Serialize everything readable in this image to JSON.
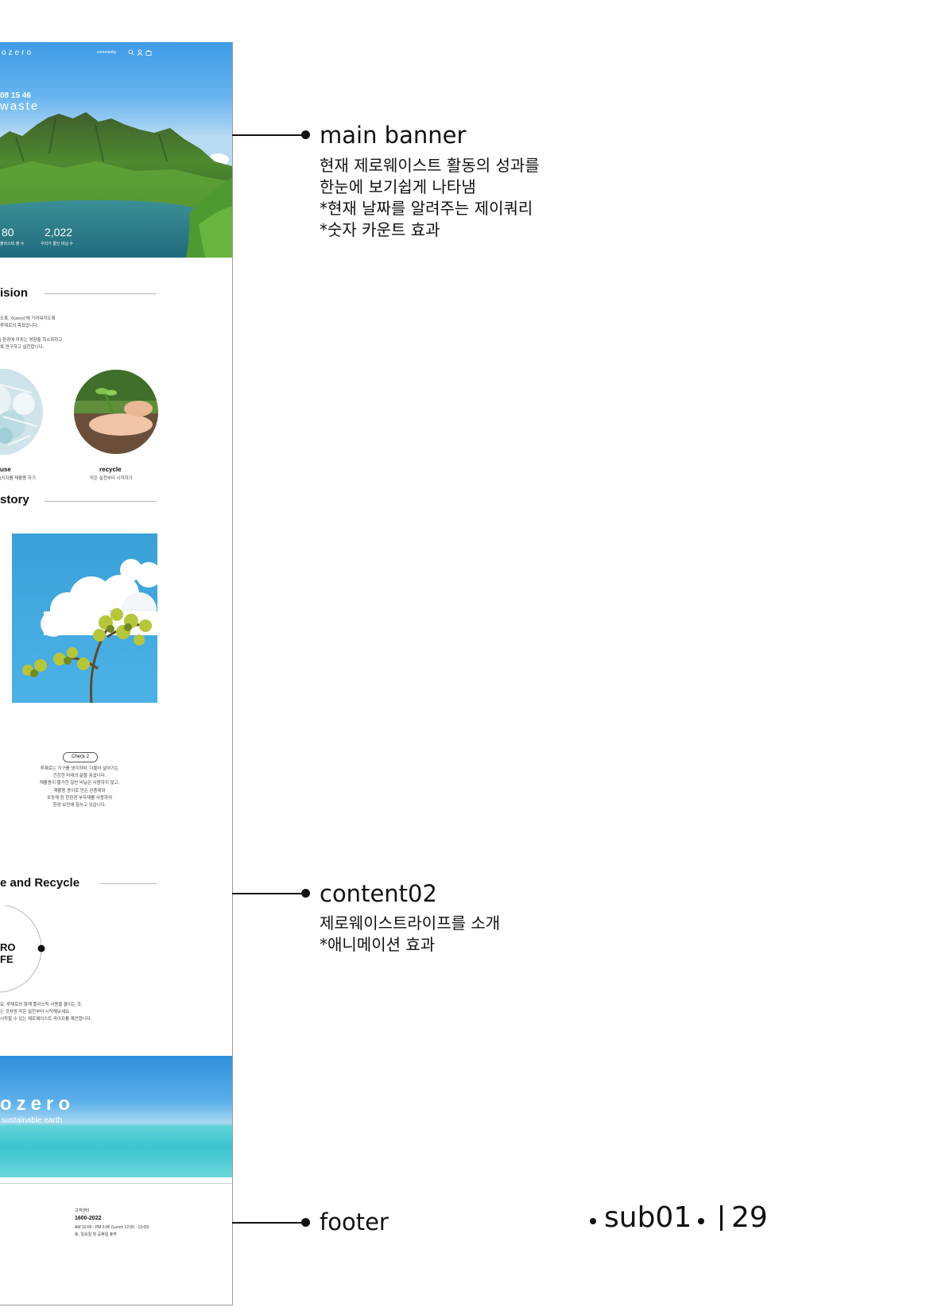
{
  "site": {
    "logo": "ozero",
    "nav": {
      "community": "community",
      "icons": [
        "search-icon",
        "user-icon",
        "cart-icon"
      ]
    },
    "banner": {
      "time": "08 15 46",
      "headline": "waste",
      "stats": [
        {
          "number": "80",
          "label": "플라스틱 병 수"
        },
        {
          "number": "2,022",
          "label": "우리가 줄인 비닐 수"
        }
      ]
    },
    "vision": {
      "title": "ision",
      "paragraph1": [
        "도록, '0(zero)'에 가까워지도록",
        "루제로의 목표입니다."
      ],
      "paragraph2": [
        "| 환경에 미치는 영향을 최소화하고",
        "록 연구하고 실천합니다."
      ],
      "items": [
        {
          "title": "use",
          "caption": "|키지를 재활용 하기"
        },
        {
          "title": "recycle",
          "caption": "작은 실천부터 시작하기"
        }
      ]
    },
    "story": {
      "title": "story",
      "badge": "Check 2",
      "lines": [
        "루제로는 지구를 생각하며, 더불어 살아가는",
        "건강한 미래의 삶을 꿈꿉니다.",
        "재활용이 불가한 일반 비닐은 사용하지 않고,",
        "재활용 종이로 만든 완충재와",
        "포장재 등 친환경 부자재를 사용하여",
        "환경 보전에 힘쓰고 있습니다."
      ]
    },
    "recycle": {
      "title": "e and Recycle",
      "circle_text": [
        "RO",
        "FE"
      ],
      "lines": [
        "요. 루제로와 함께 플라스틱 사용을 줄이는 것,",
        "는 것처럼 작은 실천부터 시작해보세요.",
        "시작할 수 있는 제로웨이스트 라이프를 제안합니다."
      ]
    },
    "bottom_banner": {
      "logo": "ozero",
      "tagline": "sustainable earth"
    },
    "footer": {
      "label": "고객센터",
      "phone": "1600-2022",
      "hours": "AM 10:00 - PM 5:00 (Lunch 12:00 - 13:00)",
      "holiday": "토, 일요일 및 공휴일 휴무"
    }
  },
  "annotations": {
    "main_banner": {
      "title": "main banner",
      "lines": [
        "현재 제로웨이스트 활동의 성과를",
        "한눈에 보기쉽게 나타냄",
        "*현재 날짜를 알려주는 제이쿼리",
        "*숫자 카운트 효과"
      ]
    },
    "content02": {
      "title": "content02",
      "lines": [
        "제로웨이스트라이프를 소개",
        "*애니메이션 효과"
      ]
    },
    "footer": {
      "title": "footer"
    }
  },
  "page_footer": {
    "section": "sub01",
    "page": "29"
  }
}
